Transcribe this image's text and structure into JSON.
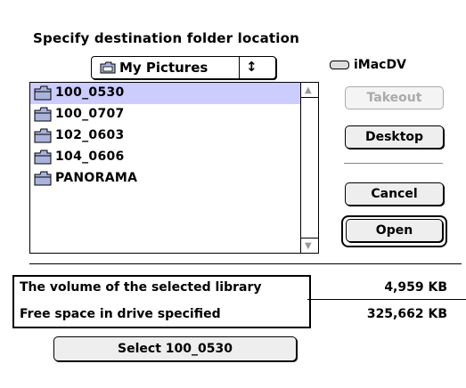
{
  "dialog": {
    "title": "Specify destination folder location",
    "location_popup": {
      "selected": "My Pictures",
      "arrows": "↕"
    },
    "volume": "iMacDV",
    "folders": [
      {
        "name": "100_0530",
        "selected": true
      },
      {
        "name": "100_0707",
        "selected": false
      },
      {
        "name": "102_0603",
        "selected": false
      },
      {
        "name": "104_0606",
        "selected": false
      },
      {
        "name": "PANORAMA",
        "selected": false
      }
    ],
    "buttons": {
      "takeout": "Takeout",
      "desktop": "Desktop",
      "cancel": "Cancel",
      "open": "Open",
      "select": "Select 100_0530"
    },
    "info": {
      "library_label": "The volume of the selected library",
      "library_value": "4,959  KB",
      "free_label": "Free space in drive specified",
      "free_value": "325,662  KB"
    },
    "icons": {
      "folder": "folder-icon",
      "scroll_up": "triangle-up-icon",
      "scroll_down": "triangle-down-icon",
      "disk": "disk-icon"
    }
  }
}
